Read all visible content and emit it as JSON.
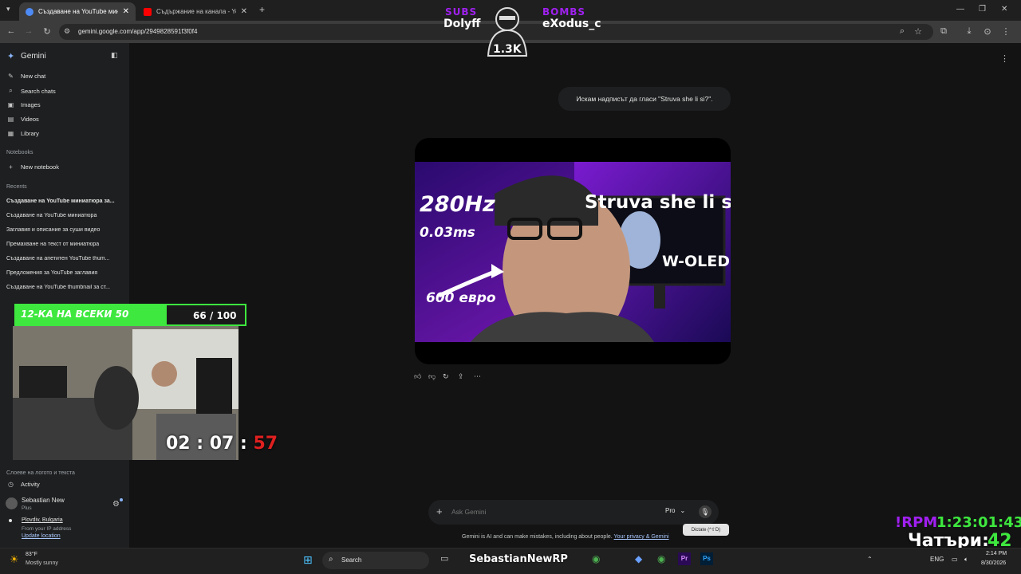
{
  "tabs": [
    {
      "title": "Създаване на YouTube миниатю",
      "active": true,
      "favicon_color": "#4e8af4"
    },
    {
      "title": "Съдържание на канала - YouTub",
      "active": false,
      "favicon_color": "#ff0000"
    }
  ],
  "toolbar": {
    "url": "gemini.google.com/app/2949828591f3f0f4"
  },
  "sidebar": {
    "brand": "Gemini",
    "menu": [
      {
        "label": "New chat",
        "icon": "edit-icon"
      },
      {
        "label": "Search chats",
        "icon": "search-icon"
      },
      {
        "label": "Images",
        "icon": "image-icon"
      },
      {
        "label": "Videos",
        "icon": "video-icon"
      },
      {
        "label": "Library",
        "icon": "library-icon"
      }
    ],
    "notebooks_header": "Notebooks",
    "new_notebook": "New notebook",
    "recents_header": "Recents",
    "recents": [
      "Създаване на YouTube миниатюра за...",
      "Създаване на YouTube миниатюра",
      "Заглавия и описание за суши видео",
      "Премахване на текст от миниатюра",
      "Създаване на апетитен YouTube thum...",
      "Предложения за YouTube заглавия",
      "Създаване на YouTube thumbnail за ст..."
    ],
    "recents_bottom": "Слоеве на логото и текста",
    "activity": "Activity",
    "user_name": "Sebastian New",
    "user_plan": "Plus",
    "location": "Plovdiv, Bulgaria",
    "location_sub": "From your IP address",
    "update_location": "Update location"
  },
  "chat": {
    "user_message": "Искам надписът да гласи \"Struva she li si?\".",
    "thumbnail": {
      "hz": "280Hz",
      "ms": "0.03ms",
      "title": "Struva she li si?",
      "badge": "W-OLED",
      "price": "600 евро"
    },
    "input_placeholder": "Ask Gemini",
    "model": "Pro",
    "tooltip": "Dictate (^⇧D)",
    "disclaimer": "Gemini is AI and can make mistakes, including about people.",
    "privacy_link": "Your privacy & Gemini"
  },
  "overlay": {
    "subs_label": "SUBS",
    "subs_name": "Dolyff",
    "bombs_label": "BOMBS",
    "bombs_name": "eXodus_c",
    "logo_count": "1.3K",
    "goal_label": "12-КА НА ВСЕКИ 50",
    "goal_value": "66 / 100",
    "goal_fraction": 0.66,
    "timer": "02 : 07 : 57",
    "rpm_label": "!RPM",
    "rpm_time": "1:23:01:43",
    "thursday_label": "Чатъри:",
    "thursday_value": "42"
  },
  "taskbar": {
    "weather_temp": "83°F",
    "weather_desc": "Mostly sunny",
    "search": "Search",
    "overlay_name": "SebastianNewRP",
    "lang": "ENG",
    "time": "2:14 PM",
    "date": "8/30/2026"
  },
  "colors": {
    "accent_green": "#3ee83e",
    "overlay_purple": "#a020f0",
    "timer_red": "#e02020"
  }
}
